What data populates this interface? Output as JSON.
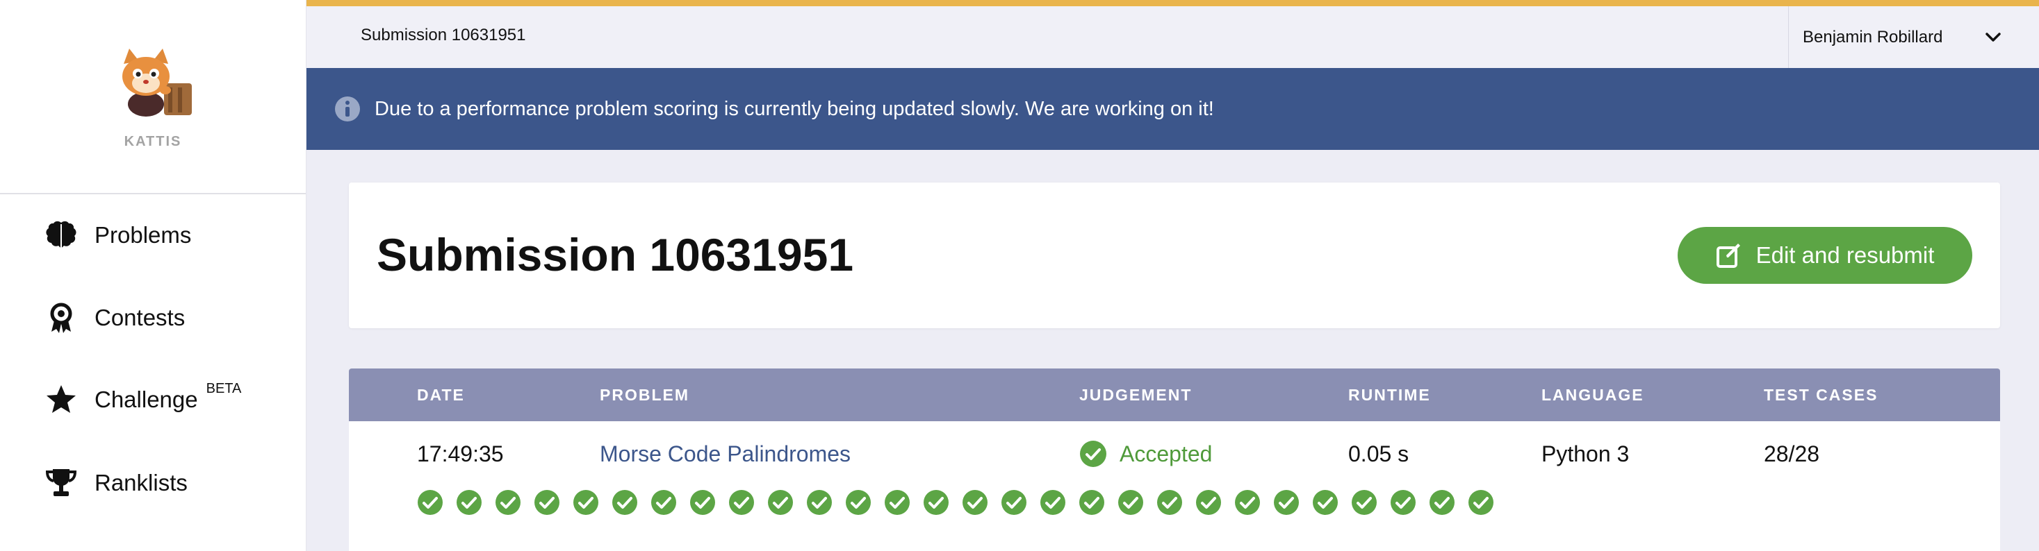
{
  "sidebar": {
    "logo_text": "KATTIS",
    "nav": [
      {
        "label": "Problems",
        "icon": "brain-icon"
      },
      {
        "label": "Contests",
        "icon": "award-icon"
      },
      {
        "label": "Challenge",
        "icon": "star-icon",
        "badge": "BETA"
      },
      {
        "label": "Ranklists",
        "icon": "trophy-icon"
      }
    ]
  },
  "topbar": {
    "breadcrumb": "Submission 10631951",
    "user_name": "Benjamin Robillard"
  },
  "banner": {
    "message": "Due to a performance problem scoring is currently being updated slowly. We are working on it!"
  },
  "page": {
    "title": "Submission 10631951",
    "resubmit_label": "Edit and resubmit"
  },
  "table": {
    "headers": [
      "DATE",
      "PROBLEM",
      "JUDGEMENT",
      "RUNTIME",
      "LANGUAGE",
      "TEST CASES"
    ],
    "row": {
      "date": "17:49:35",
      "problem": "Morse Code Palindromes",
      "judgement": "Accepted",
      "runtime": "0.05 s",
      "language": "Python 3",
      "test_cases": "28/28"
    },
    "test_results_passed": 28
  },
  "colors": {
    "accent_top": "#e9b44c",
    "banner_bg": "#3c568b",
    "success": "#5ca545",
    "header_bg": "#8a8fb3"
  }
}
